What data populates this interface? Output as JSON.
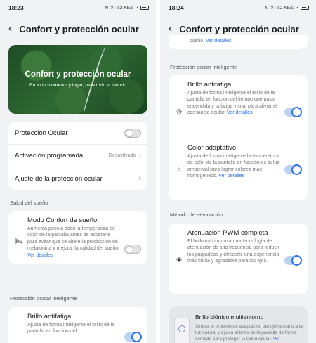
{
  "left": {
    "status": {
      "time": "18:23",
      "net": "0.2 KB/s",
      "battery": "56"
    },
    "header": {
      "title": "Confort y protección ocular"
    },
    "hero": {
      "title": "Confort y protección ocular",
      "subtitle": "En todo momento y lugar, para todo el mundo"
    },
    "settings": [
      {
        "label": "Protección Ocular",
        "type": "toggle",
        "on": false
      },
      {
        "label": "Activación programada",
        "type": "nav",
        "value": "Desactivado"
      },
      {
        "label": "Ajuste de la protección ocular",
        "type": "nav",
        "value": ""
      }
    ],
    "sleep_section": "Salud del sueño",
    "sleep": {
      "title": "Modo Confort de sueño",
      "desc": "Aumenta poco a poco la temperatura de color de la pantalla antes de acostarte para evitar que se altere la producción de melatonina y mejorar la calidad del sueño.",
      "link": "Ver detalles",
      "icon": "bed-icon",
      "on": false
    },
    "smart_section": "Protección ocular inteligente",
    "brightness": {
      "title": "Brillo antifatiga",
      "desc": "Ajusta de forma inteligente el brillo de la pantalla en función del",
      "on": true
    }
  },
  "right": {
    "status": {
      "time": "18:24",
      "net": "0.2 KB/s",
      "battery": "56"
    },
    "header": {
      "title": "Confort y protección ocular"
    },
    "top_fragment": {
      "text": "sueño.",
      "link": "Ver detalles"
    },
    "smart_section": "Protección ocular inteligente",
    "smart_items": [
      {
        "title": "Brillo antifatiga",
        "desc": "Ajusta de forma inteligente el brillo de la pantalla en función del tiempo que pasa encendida y la fatiga visual para aliviar el cansancio ocular.",
        "link": "Ver detalles",
        "icon": "clock-icon",
        "on": true
      },
      {
        "title": "Color adaptativo",
        "desc": "Ajusta de forma inteligente la temperatura de color de la pantalla en función de la luz ambiental para lograr colores más homogéneos.",
        "link": "Ver detalles",
        "icon": "sun-icon",
        "on": true
      }
    ],
    "dimming_section": "Método de atenuación",
    "pwm": {
      "title": "Atenuación PWM completa",
      "desc": "El brillo máximo usa una tecnología de atenuación de alta frecuencia para reducir los parpadeos y ofrecerte una experiencia más fluida y agradable para los ojos.",
      "icon": "eye-icon",
      "on": true
    },
    "bionic": {
      "title": "Brillo biónico multientorno",
      "desc": "Simula el proceso de adaptación del ojo humano a la luz natural y ajusta el brillo de la pantalla de forma cómoda para proteger la salud ocular.",
      "link": "Ver"
    }
  }
}
